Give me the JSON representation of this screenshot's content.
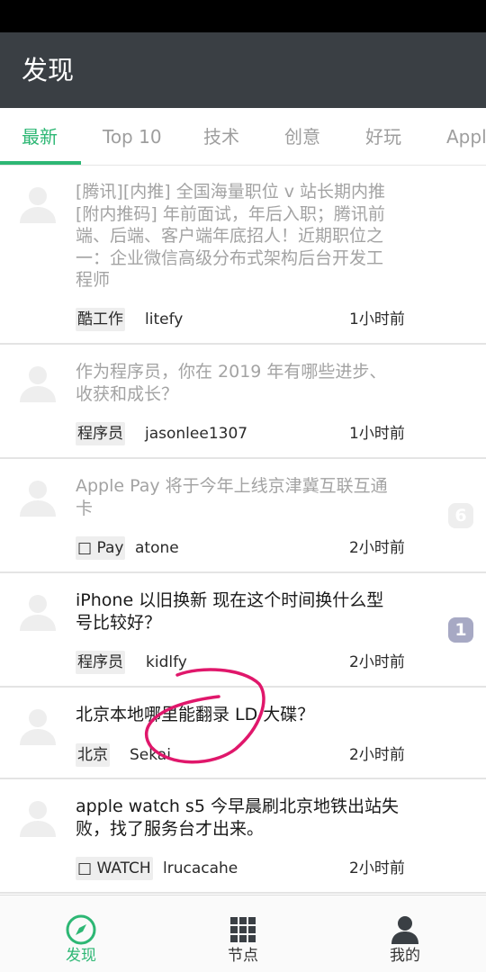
{
  "appbar": {
    "title": "发现"
  },
  "tabs": [
    {
      "label": "最新",
      "active": true
    },
    {
      "label": "Top 10",
      "active": false
    },
    {
      "label": "技术",
      "active": false
    },
    {
      "label": "创意",
      "active": false
    },
    {
      "label": "好玩",
      "active": false
    },
    {
      "label": "Apple",
      "active": false
    }
  ],
  "topics": [
    {
      "title_lines": [
        "[腾讯][内推] 全国海量职位 v 站长期内推",
        "[附内推码] 年前面试，年后入职；腾讯前",
        "端、后端、客户端年底招人！近期职位之",
        "一：企业微信高级分布式架构后台开发工",
        "程师"
      ],
      "read": true,
      "node": "酷工作",
      "user": "litefy",
      "time": "1小时前",
      "replies": null
    },
    {
      "title_lines": [
        "作为程序员，你在 2019 年有哪些进步、",
        "收获和成长？"
      ],
      "read": true,
      "node": "程序员",
      "user": "jasonlee1307",
      "time": "1小时前",
      "replies": null
    },
    {
      "title_lines": [
        "Apple Pay 将于今年上线京津冀互联互通",
        "卡"
      ],
      "read": true,
      "node": " Pay",
      "user": "atone",
      "time": "2小时前",
      "replies": "6"
    },
    {
      "title_lines": [
        "iPhone 以旧换新 现在这个时间换什么型",
        "号比较好？"
      ],
      "read": false,
      "node": "程序员",
      "user": "kidlfy",
      "time": "2小时前",
      "replies": "1"
    },
    {
      "title_lines": [
        "北京本地哪里能翻录 LD 大碟？"
      ],
      "read": false,
      "node": "北京",
      "user": "Sekai",
      "time": "2小时前",
      "replies": null
    },
    {
      "title_lines": [
        "apple watch s5 今早晨刷北京地铁出站失",
        "败，找了服务台才出来。"
      ],
      "read": false,
      "node": " WATCH",
      "user": "lrucacahe",
      "time": "2小时前",
      "replies": null
    }
  ],
  "bottom_nav": [
    {
      "label": "发现",
      "icon": "compass-icon",
      "active": true
    },
    {
      "label": "节点",
      "icon": "grid-icon",
      "active": false
    },
    {
      "label": "我的",
      "icon": "person-icon",
      "active": false
    }
  ],
  "colors": {
    "accent": "#2db774",
    "appbar": "#3a3f44",
    "annotation": "#e0176b"
  }
}
